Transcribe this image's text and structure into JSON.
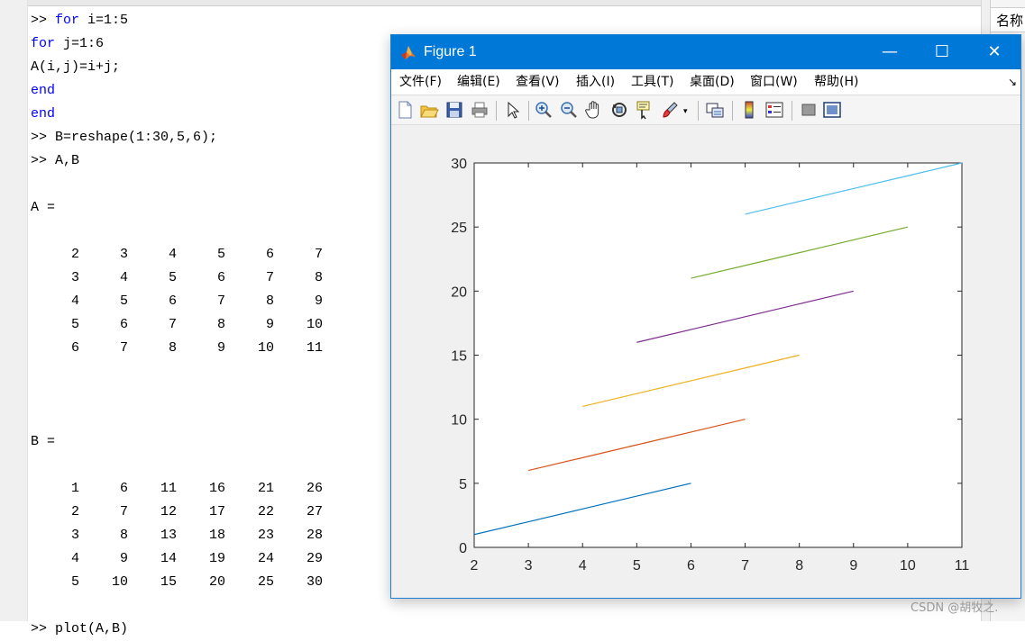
{
  "command_window": {
    "lines": [
      {
        "prompt": ">> ",
        "keyword": "for",
        "rest": " i=1:5"
      },
      {
        "prompt": "",
        "keyword": "for",
        "rest": " j=1:6"
      },
      {
        "prompt": "",
        "keyword": "",
        "rest": "A(i,j)=i+j;"
      },
      {
        "prompt": "",
        "keyword": "end",
        "rest": ""
      },
      {
        "prompt": "",
        "keyword": "end",
        "rest": ""
      },
      {
        "prompt": ">> ",
        "keyword": "",
        "rest": "B=reshape(1:30,5,6);"
      },
      {
        "prompt": ">> ",
        "keyword": "",
        "rest": "A,B"
      }
    ],
    "a_label": "A =",
    "matrix_a": [
      [
        2,
        3,
        4,
        5,
        6,
        7
      ],
      [
        3,
        4,
        5,
        6,
        7,
        8
      ],
      [
        4,
        5,
        6,
        7,
        8,
        9
      ],
      [
        5,
        6,
        7,
        8,
        9,
        10
      ],
      [
        6,
        7,
        8,
        9,
        10,
        11
      ]
    ],
    "b_label": "B =",
    "matrix_b": [
      [
        1,
        6,
        11,
        16,
        21,
        26
      ],
      [
        2,
        7,
        12,
        17,
        22,
        27
      ],
      [
        3,
        8,
        13,
        18,
        23,
        28
      ],
      [
        4,
        9,
        14,
        19,
        24,
        29
      ],
      [
        5,
        10,
        15,
        20,
        25,
        30
      ]
    ],
    "last_command": ">> plot(A,B)"
  },
  "workspace": {
    "header": "名称"
  },
  "figure": {
    "title": "Figure 1",
    "window_buttons": {
      "minimize": "—",
      "maximize": "☐",
      "close": "✕"
    },
    "menu": [
      "文件(F)",
      "编辑(E)",
      "查看(V)",
      "插入(I)",
      "工具(T)",
      "桌面(D)",
      "窗口(W)",
      "帮助(H)"
    ],
    "menu_arrow": "↘",
    "toolbar": [
      "new-figure-icon",
      "open-file-icon",
      "save-icon",
      "print-icon",
      "pointer-icon",
      "zoom-in-icon",
      "zoom-out-icon",
      "pan-hand-icon",
      "rotate-3d-icon",
      "data-cursor-icon",
      "brush-icon",
      "link-plot-icon",
      "colorbar-icon",
      "legend-icon",
      "hide-plot-tools-icon",
      "show-plot-tools-icon"
    ]
  },
  "chart_data": {
    "type": "line",
    "xlim": [
      2,
      11
    ],
    "ylim": [
      0,
      30
    ],
    "xticks": [
      2,
      3,
      4,
      5,
      6,
      7,
      8,
      9,
      10,
      11
    ],
    "yticks": [
      0,
      5,
      10,
      15,
      20,
      25,
      30
    ],
    "series": [
      {
        "color": "#0072bd",
        "x": [
          2,
          3,
          4,
          5,
          6
        ],
        "y": [
          1,
          2,
          3,
          4,
          5
        ]
      },
      {
        "color": "#d95319",
        "x": [
          3,
          4,
          5,
          6,
          7
        ],
        "y": [
          6,
          7,
          8,
          9,
          10
        ]
      },
      {
        "color": "#edb120",
        "x": [
          4,
          5,
          6,
          7,
          8
        ],
        "y": [
          11,
          12,
          13,
          14,
          15
        ]
      },
      {
        "color": "#7e2f8e",
        "x": [
          5,
          6,
          7,
          8,
          9
        ],
        "y": [
          16,
          17,
          18,
          19,
          20
        ]
      },
      {
        "color": "#77ac30",
        "x": [
          6,
          7,
          8,
          9,
          10
        ],
        "y": [
          21,
          22,
          23,
          24,
          25
        ]
      },
      {
        "color": "#4dbeee",
        "x": [
          7,
          8,
          9,
          10,
          11
        ],
        "y": [
          26,
          27,
          28,
          29,
          30
        ]
      }
    ]
  },
  "watermark": "CSDN @胡牧之."
}
